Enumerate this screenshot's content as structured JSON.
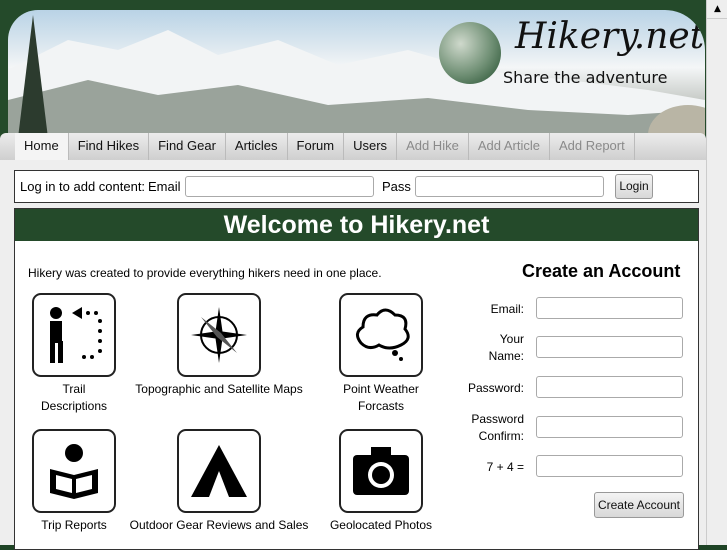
{
  "logo": {
    "title": "Hikery.net",
    "tagline": "Share the adventure"
  },
  "nav": [
    {
      "label": "Home",
      "state": "active"
    },
    {
      "label": "Find Hikes"
    },
    {
      "label": "Find Gear"
    },
    {
      "label": "Articles"
    },
    {
      "label": "Forum"
    },
    {
      "label": "Users"
    },
    {
      "label": "Add Hike",
      "state": "disabled"
    },
    {
      "label": "Add Article",
      "state": "disabled"
    },
    {
      "label": "Add Report",
      "state": "disabled"
    }
  ],
  "login": {
    "prompt": "Log in to add content:",
    "email_label": "Email",
    "email_value": "",
    "pass_label": "Pass",
    "pass_value": "",
    "button": "Login"
  },
  "welcome": "Welcome to Hikery.net",
  "intro": "Hikery was created to provide everything hikers need in one place.",
  "features": [
    {
      "label": "Trail Descriptions",
      "icon": "hiker-icon"
    },
    {
      "label": "Topographic and Satellite Maps",
      "icon": "compass-icon"
    },
    {
      "label": "Point Weather Forcasts",
      "icon": "cloud-icon"
    },
    {
      "label": "Trip Reports",
      "icon": "reader-icon"
    },
    {
      "label": "Outdoor Gear Reviews and Sales",
      "icon": "tent-icon"
    },
    {
      "label": "Geolocated Photos",
      "icon": "camera-icon"
    }
  ],
  "account": {
    "title": "Create an Account",
    "email": "Email:",
    "name": "Your Name:",
    "password": "Password:",
    "confirm": "Password Confirm:",
    "captcha": "7 + 4 =",
    "button": "Create Account"
  }
}
